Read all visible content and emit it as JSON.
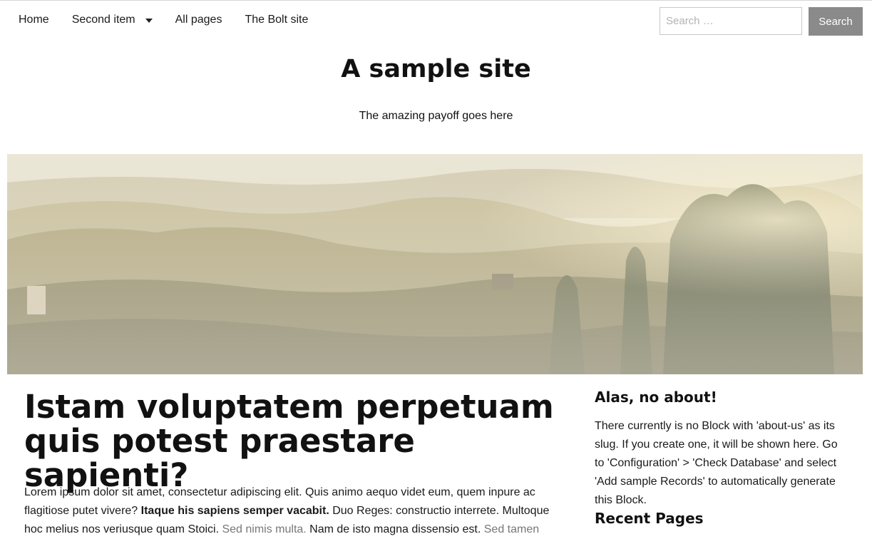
{
  "nav": {
    "items": [
      {
        "label": "Home",
        "has_dropdown": false
      },
      {
        "label": "Second item",
        "has_dropdown": true
      },
      {
        "label": "All pages",
        "has_dropdown": false
      },
      {
        "label": "The Bolt site",
        "has_dropdown": false
      }
    ]
  },
  "search": {
    "placeholder": "Search …",
    "button_label": "Search"
  },
  "header": {
    "title": "A sample site",
    "payoff": "The amazing payoff goes here"
  },
  "article": {
    "title": "Istam voluptatem perpetuam quis potest praestare sapienti?",
    "p1_a": "Lorem ipsum dolor sit amet, consectetur adipiscing elit. Quis animo aequo videt eum, quem inpure ac flagitiose putet vivere? ",
    "p1_bold": "Itaque his sapiens semper vacabit.",
    "p1_b": " Duo Reges: constructio interrete. Multoque hoc melius nos veriusque quam Stoici. ",
    "p1_link1": "Sed nimis multa.",
    "p1_c": " Nam de isto magna dissensio est. ",
    "p1_link2": "Sed tamen"
  },
  "aside": {
    "heading": "Alas, no about!",
    "text": "There currently is no Block with 'about-us' as its slug. If you create one, it will be shown here. Go to 'Configuration' > 'Check Database' and select 'Add sample Records' to automatically generate this Block.",
    "recent_heading": "Recent Pages"
  },
  "colors": {
    "search_button": "#8a8a8a",
    "link": "#777777",
    "text": "#111111"
  },
  "icons": {
    "dropdown": "caret-down-icon"
  }
}
